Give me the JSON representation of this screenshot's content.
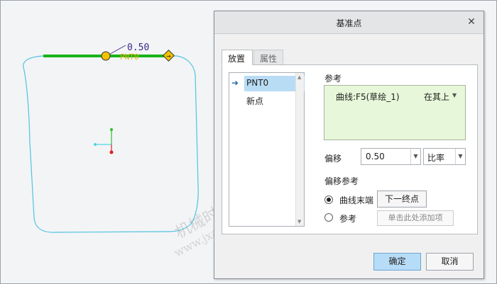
{
  "canvas": {
    "dimension_value": "0.50",
    "point_label": "PNT0",
    "colors": {
      "background": "#f3f4f6",
      "profile": "#4fc3e0",
      "highlight_curve": "#18b418",
      "point_fill": "#f2c200",
      "axis_x": "#4fd6e0",
      "axis_y": "#2bbf2b",
      "axis_origin": "#e02020"
    },
    "icons": [
      "point-marker-icon",
      "end-marker-icon",
      "coordinate-axes-icon"
    ]
  },
  "watermark": {
    "text_cn": "机械时代网",
    "text_url": "www.jxage.com"
  },
  "dialog": {
    "title": "基准点",
    "close_icon": "close-icon",
    "tabs": [
      {
        "label": "放置",
        "active": true
      },
      {
        "label": "属性",
        "active": false
      }
    ],
    "point_list": {
      "items": [
        "PNT0",
        "新点"
      ],
      "selected_index": 0,
      "current_icon": "right-arrow-icon"
    },
    "reference": {
      "label": "参考",
      "curve": "曲线:F5(草绘_1)",
      "constraint": "在其上"
    },
    "offset": {
      "label": "偏移",
      "value": "0.50",
      "mode": "比率"
    },
    "offset_reference": {
      "label": "偏移参考",
      "options": [
        {
          "label": "曲线末端",
          "checked": true
        },
        {
          "label": "参考",
          "checked": false
        }
      ],
      "next_end_button": "下一终点",
      "add_item_placeholder": "单击此处添加项"
    },
    "buttons": {
      "ok": "确定",
      "cancel": "取消"
    },
    "colors": {
      "reference_box": "#e7f7d9",
      "selected_item": "#b9dcf5",
      "ok_button": "#b6dcf7"
    }
  }
}
